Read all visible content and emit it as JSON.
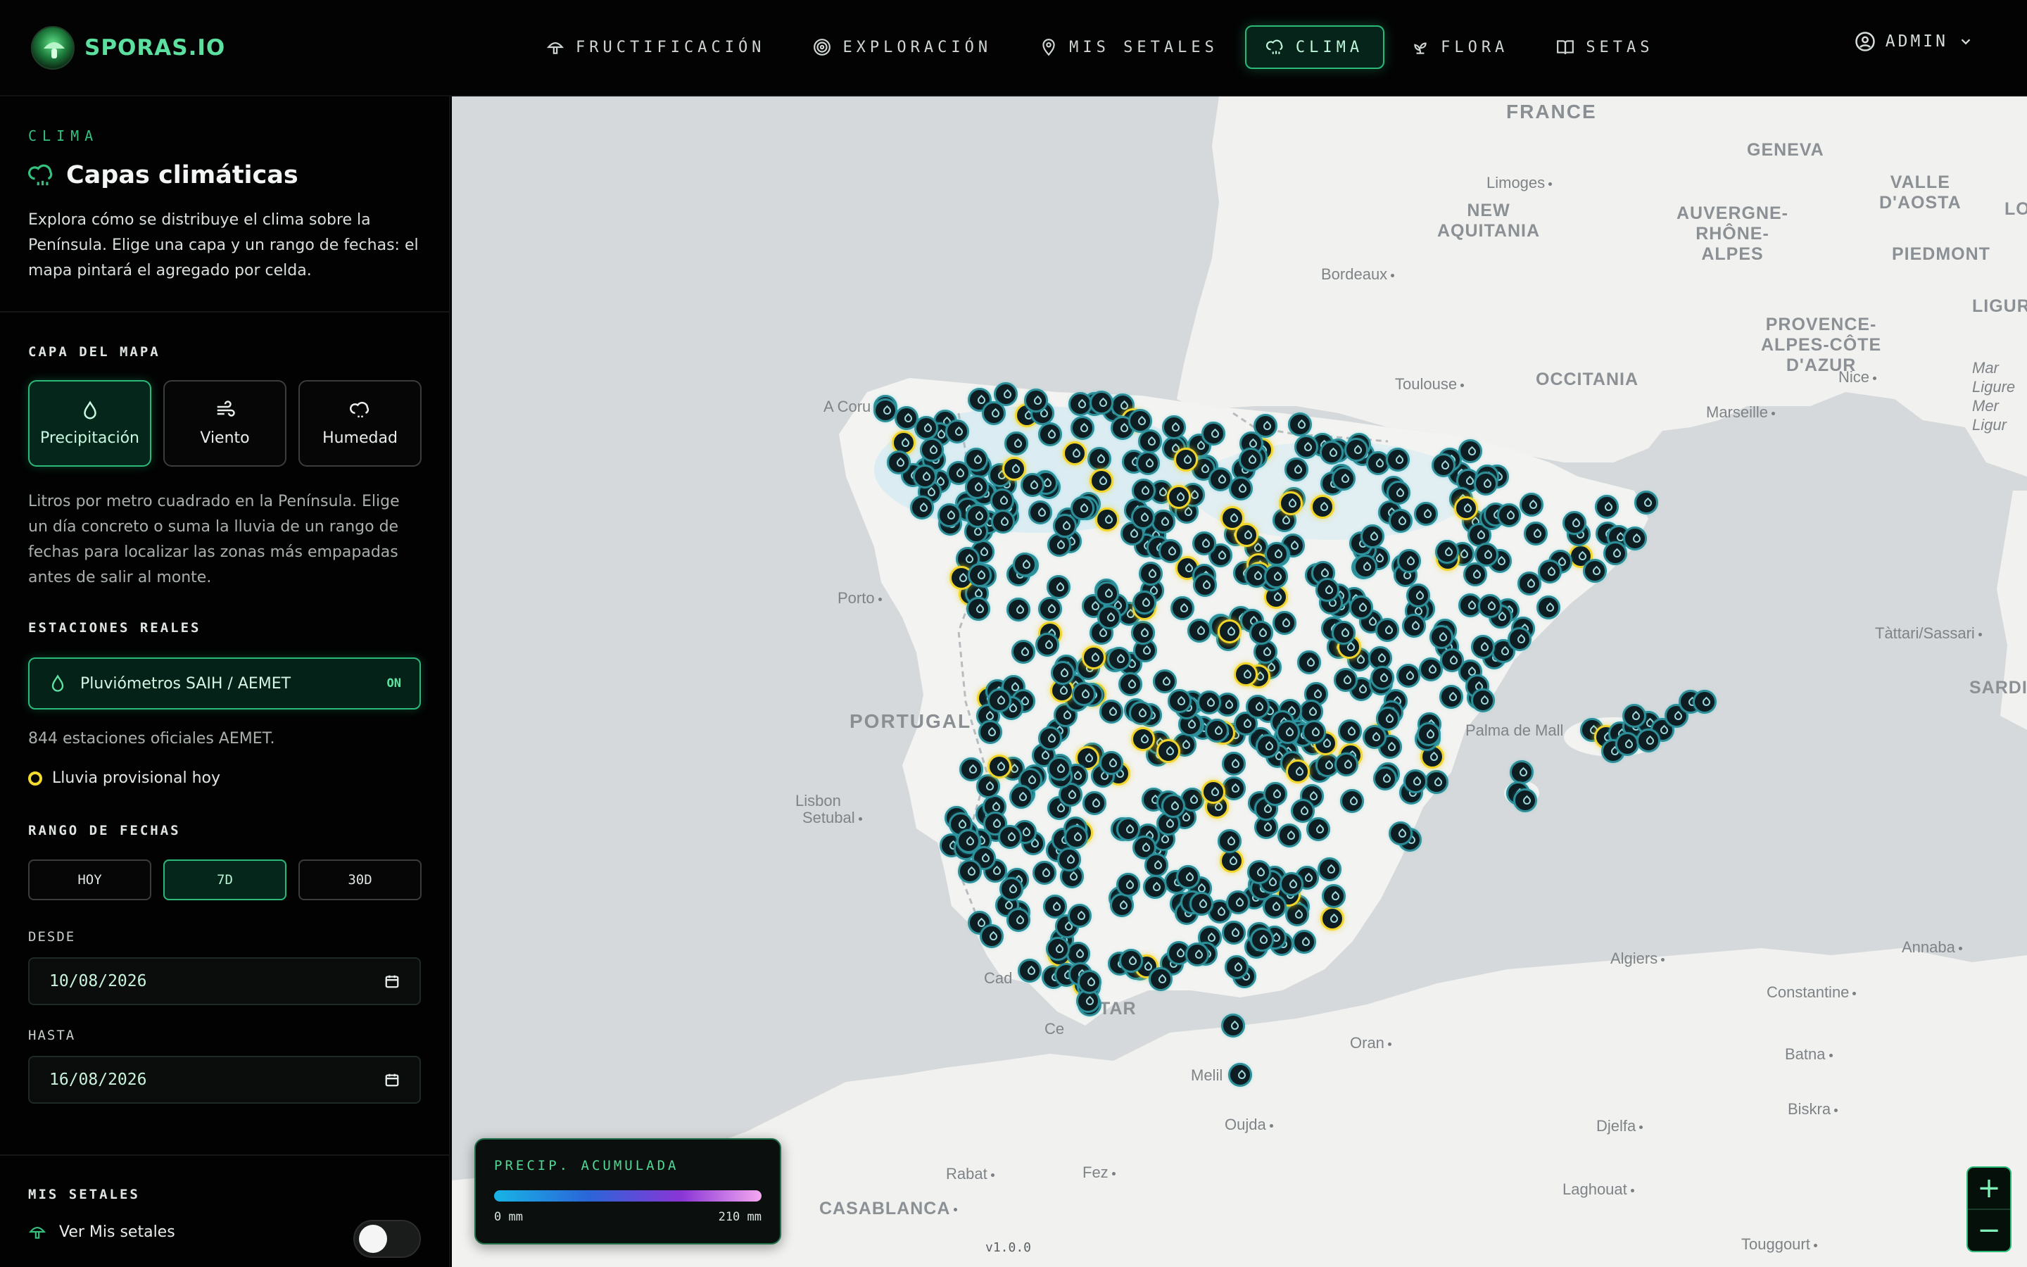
{
  "app": {
    "name": "SPORAS.IO"
  },
  "nav": {
    "items": [
      {
        "label": "FRUCTIFICACIÓN",
        "icon": "mushroom-icon",
        "active": false
      },
      {
        "label": "EXPLORACIÓN",
        "icon": "target-icon",
        "active": false
      },
      {
        "label": "MIS SETALES",
        "icon": "map-pin-icon",
        "active": false
      },
      {
        "label": "CLIMA",
        "icon": "cloud-rain-icon",
        "active": true
      },
      {
        "label": "FLORA",
        "icon": "sprout-icon",
        "active": false
      },
      {
        "label": "SETAS",
        "icon": "book-icon",
        "active": false
      }
    ],
    "user": "ADMIN"
  },
  "sidebar": {
    "eyebrow": "CLIMA",
    "title": "Capas climáticas",
    "intro": "Explora cómo se distribuye el clima sobre la Península. Elige una capa y un rango de fechas: el mapa pintará el agregado por celda.",
    "layer_section": "CAPA DEL MAPA",
    "layers": [
      {
        "label": "Precipitación",
        "icon": "droplet-icon",
        "active": true
      },
      {
        "label": "Viento",
        "icon": "wind-icon",
        "active": false
      },
      {
        "label": "Humedad",
        "icon": "cloud-drizzle-icon",
        "active": false
      }
    ],
    "layer_desc": "Litros por metro cuadrado en la Península. Elige un día concreto o suma la lluvia de un rango de fechas para localizar las zonas más empapadas antes de salir al monte.",
    "stations_section": "ESTACIONES REALES",
    "stations_toggle": {
      "label": "Pluviómetros SAIH / AEMET",
      "state": "ON"
    },
    "stations_count": "844 estaciones oficiales AEMET.",
    "provisional_legend": "Lluvia provisional hoy",
    "range_section": "RANGO DE FECHAS",
    "ranges": [
      {
        "label": "HOY",
        "active": false
      },
      {
        "label": "7D",
        "active": true
      },
      {
        "label": "30D",
        "active": false
      }
    ],
    "from_label": "DESDE",
    "from_value": "10/08/2026",
    "to_label": "HASTA",
    "to_value": "16/08/2026",
    "setales_section": "MIS SETALES",
    "setales_toggle_label": "Ver Mis setales",
    "setales_toggle_on": false
  },
  "map": {
    "labels": {
      "france": "FRANCE",
      "portugal": "PORTUGAL",
      "nouvelle_aquitaine": "NEW\nAQUITANIA",
      "occitania": "OCCITANIA",
      "auvergne": "AUVERGNE-\nRHÔNE-\nALPES",
      "provence": "PROVENCE-\nALPES-CÔTE\nD'AZUR",
      "piedmont": "PIEDMONT",
      "liguria": "LIGURIA",
      "valle_aosta": "VALLE\nD'AOSTA",
      "geneva": "GENEVA",
      "limoges": "Limoges",
      "bordeaux": "Bordeaux",
      "toulouse": "Toulouse",
      "marseille": "Marseille",
      "nice": "Nice",
      "porto": "Porto",
      "lisbon": "Lisbon",
      "setubal": "Setubal",
      "a_coruna": "A Coru",
      "palma": "Palma de Mall",
      "algiers": "Algiers",
      "annaba": "Annaba",
      "constantine": "Constantine",
      "oran": "Oran",
      "melilla": "Melil",
      "oujda": "Oujda",
      "batna": "Batna",
      "biskra": "Biskra",
      "djelfa": "Djelfa",
      "laghouat": "Laghouat",
      "touggourt": "Touggourt",
      "rabat": "Rabat",
      "fez": "Fez",
      "casablanca": "CASABLANCA",
      "tattari": "Tàttari/Sassari",
      "sardinia": "SARDI",
      "lo": "LO",
      "gibraltar": "TAR",
      "cadiz": "Cad",
      "ceuta": "Ce",
      "mar_ligure": "Mar\nLigure\nMer\nLigur"
    },
    "legend": {
      "title": "PRECIP. ACUMULADA",
      "min": "0 mm",
      "max": "210 mm"
    },
    "version": "v1.0.0",
    "zoom_in": "+",
    "zoom_out": "−"
  },
  "colors": {
    "accent": "#2bb97a",
    "marker_border": "#2d8e98",
    "marker_provisional": "#f2d52a"
  }
}
